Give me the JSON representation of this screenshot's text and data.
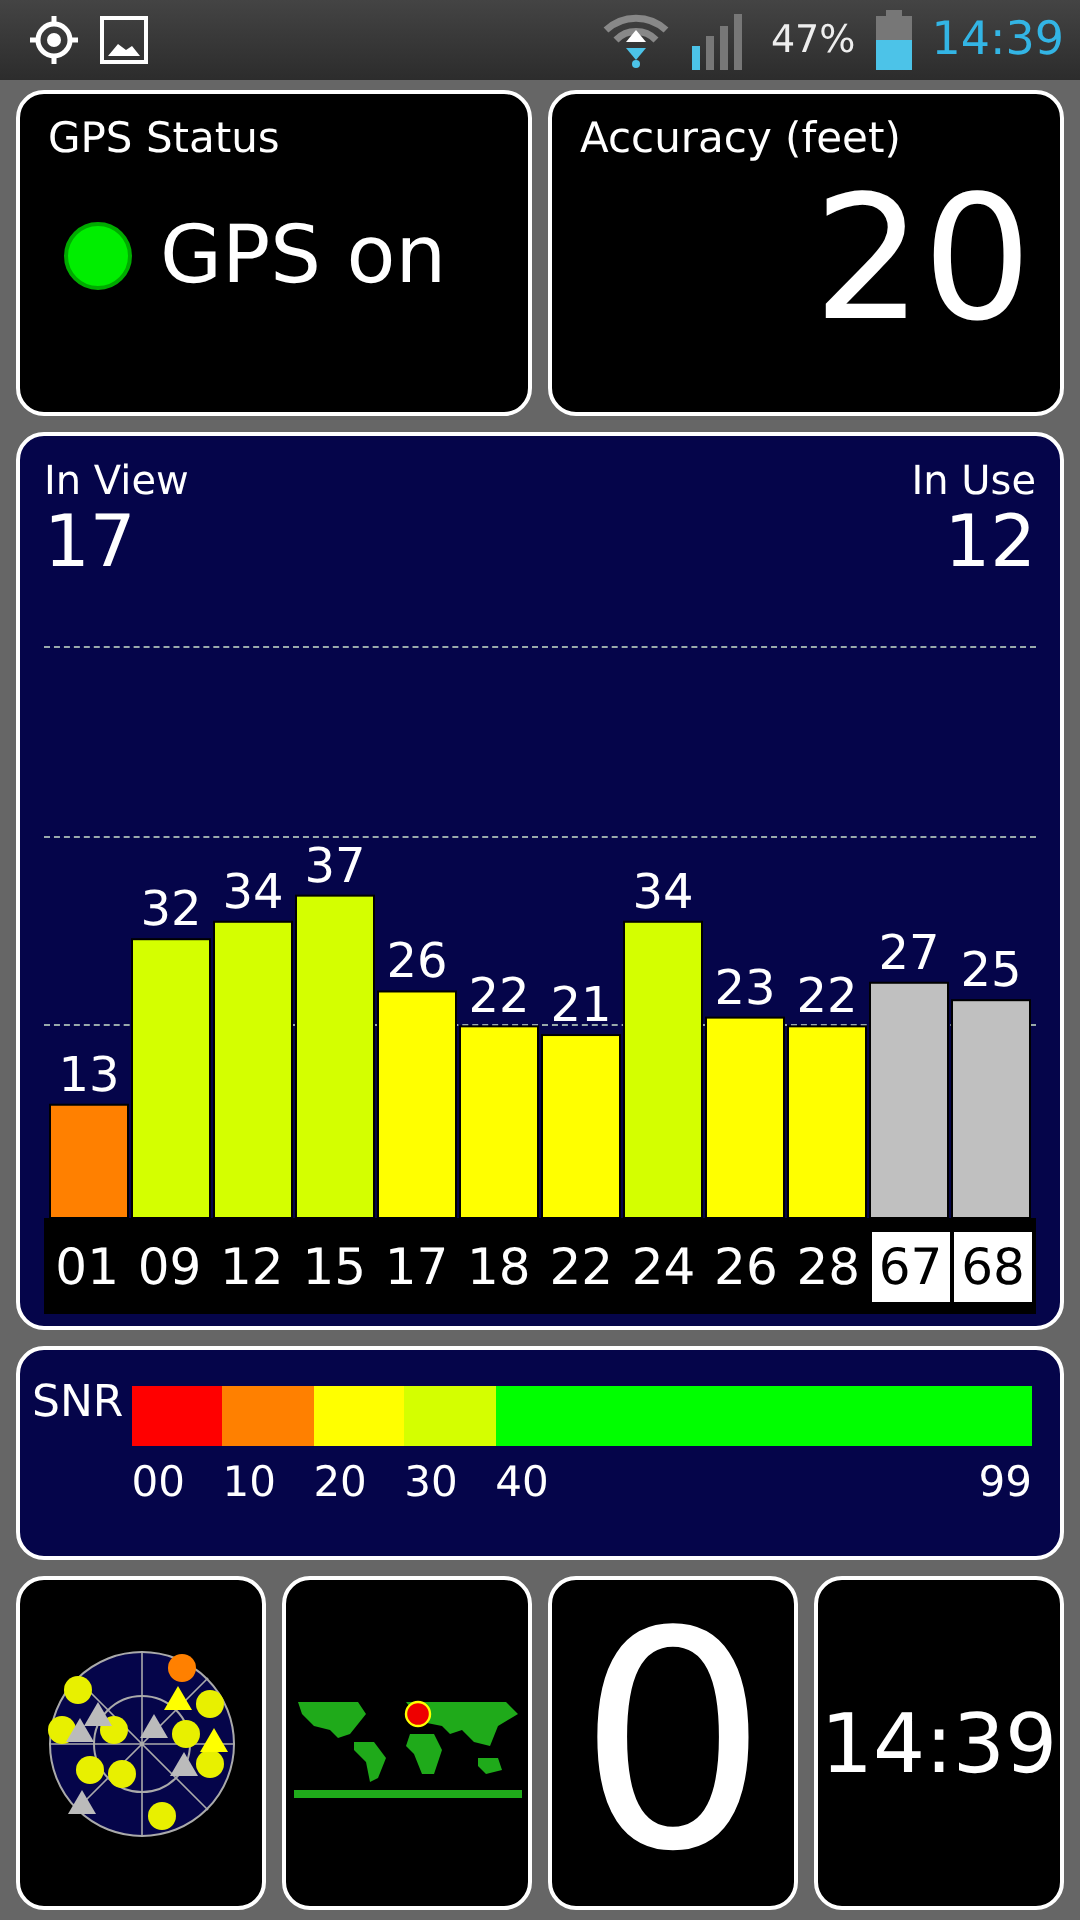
{
  "status_bar": {
    "battery": "47%",
    "time": "14:39"
  },
  "gps_status": {
    "title": "GPS Status",
    "state": "GPS on",
    "on": true
  },
  "accuracy": {
    "title": "Accuracy (feet)",
    "value": "20"
  },
  "satellites_panel": {
    "in_view_label": "In View",
    "in_view": "17",
    "in_use_label": "In Use",
    "in_use": "12",
    "chart_data": {
      "type": "bar",
      "categories": [
        "01",
        "09",
        "12",
        "15",
        "17",
        "18",
        "22",
        "24",
        "26",
        "28",
        "67",
        "68"
      ],
      "values": [
        13,
        32,
        34,
        37,
        26,
        22,
        21,
        34,
        23,
        22,
        27,
        25
      ],
      "data_labels": true
    },
    "satellites": [
      {
        "in_use": true
      },
      {
        "in_use": true
      },
      {
        "in_use": true
      },
      {
        "in_use": true
      },
      {
        "in_use": true
      },
      {
        "in_use": true
      },
      {
        "in_use": true
      },
      {
        "in_use": true
      },
      {
        "in_use": true
      },
      {
        "in_use": true
      },
      {
        "in_use": false
      },
      {
        "in_use": false
      }
    ]
  },
  "snr_legend": {
    "label": "SNR",
    "segments": [
      {
        "label": "00",
        "color": "#ff0000"
      },
      {
        "label": "10",
        "color": "#ff8000"
      },
      {
        "label": "20",
        "color": "#ffff00"
      },
      {
        "label": "30",
        "color": "#d4ff00"
      },
      {
        "label": "40",
        "color": "#00ff00"
      }
    ],
    "end_label": "99"
  },
  "tiles": {
    "counter": "0",
    "clock": "14:39"
  }
}
